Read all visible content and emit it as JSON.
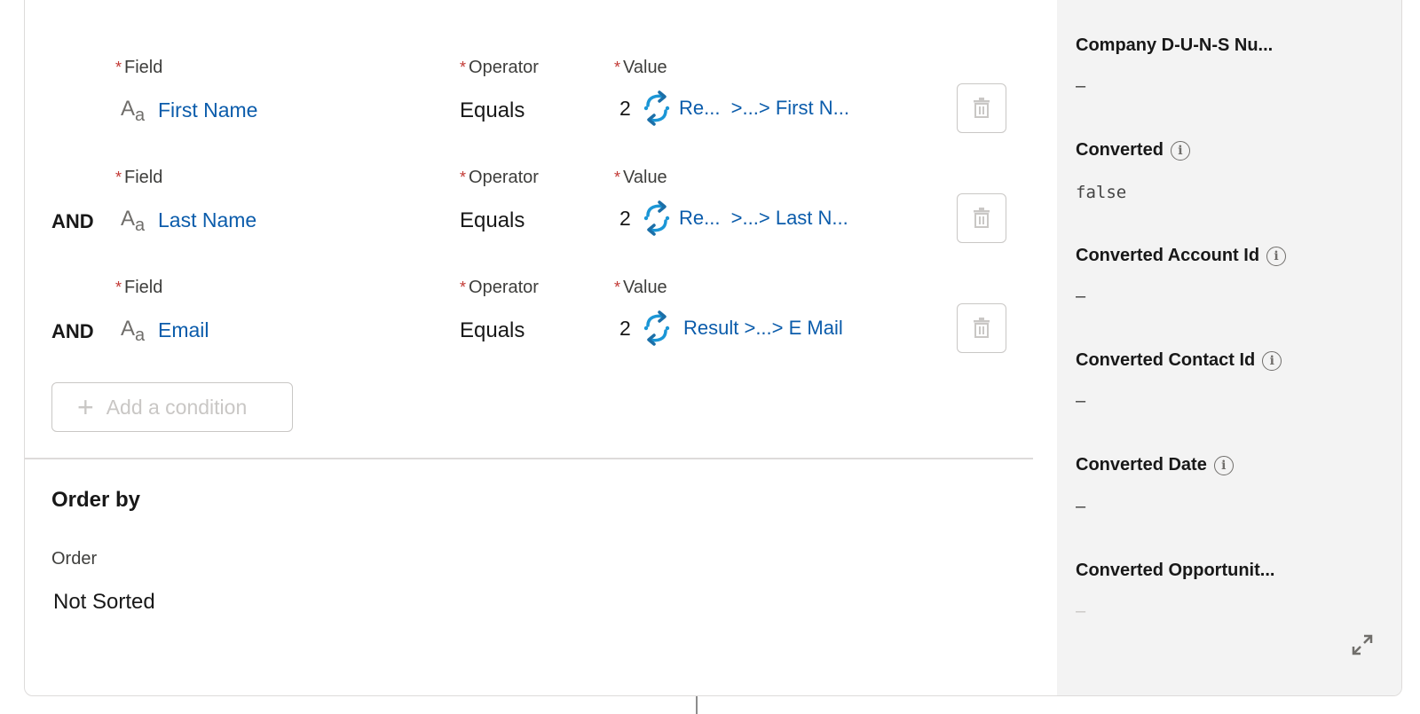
{
  "conditions": {
    "field_label": "Field",
    "operator_label": "Operator",
    "value_label": "Value",
    "rows": [
      {
        "connector": "",
        "field": "First Name",
        "operator": "Equals",
        "value_num": "2",
        "value_text": "Re...  >...> First N..."
      },
      {
        "connector": "AND",
        "field": "Last Name",
        "operator": "Equals",
        "value_num": "2",
        "value_text": "Re...  >...> Last N..."
      },
      {
        "connector": "AND",
        "field": "Email",
        "operator": "Equals",
        "value_num": "2",
        "value_text": "Result >...> E Mail"
      }
    ],
    "add_condition_label": "Add a condition"
  },
  "order_by": {
    "title": "Order by",
    "order_label": "Order",
    "order_value": "Not Sorted"
  },
  "record_panel": {
    "fields": [
      {
        "label": "Company D-U-N-S Nu...",
        "value": "–",
        "info": false
      },
      {
        "label": "Converted",
        "value": "false",
        "info": true
      },
      {
        "label": "Converted Account Id",
        "value": "–",
        "info": true
      },
      {
        "label": "Converted Contact Id",
        "value": "–",
        "info": true
      },
      {
        "label": "Converted Date",
        "value": "–",
        "info": true
      },
      {
        "label": "Converted Opportunit...",
        "value": "–",
        "info": false
      }
    ]
  },
  "icons": {
    "field_type": "text-field-icon",
    "value_resource": "resource-sync-icon",
    "trash": "trash-icon",
    "add": "plus-icon",
    "info": "info-icon",
    "expand": "expand-icon"
  },
  "colors": {
    "link": "#0b5cab",
    "required": "#c23934",
    "panel_bg": "#f3f3f3",
    "icon_blue": "#1b96d6"
  }
}
